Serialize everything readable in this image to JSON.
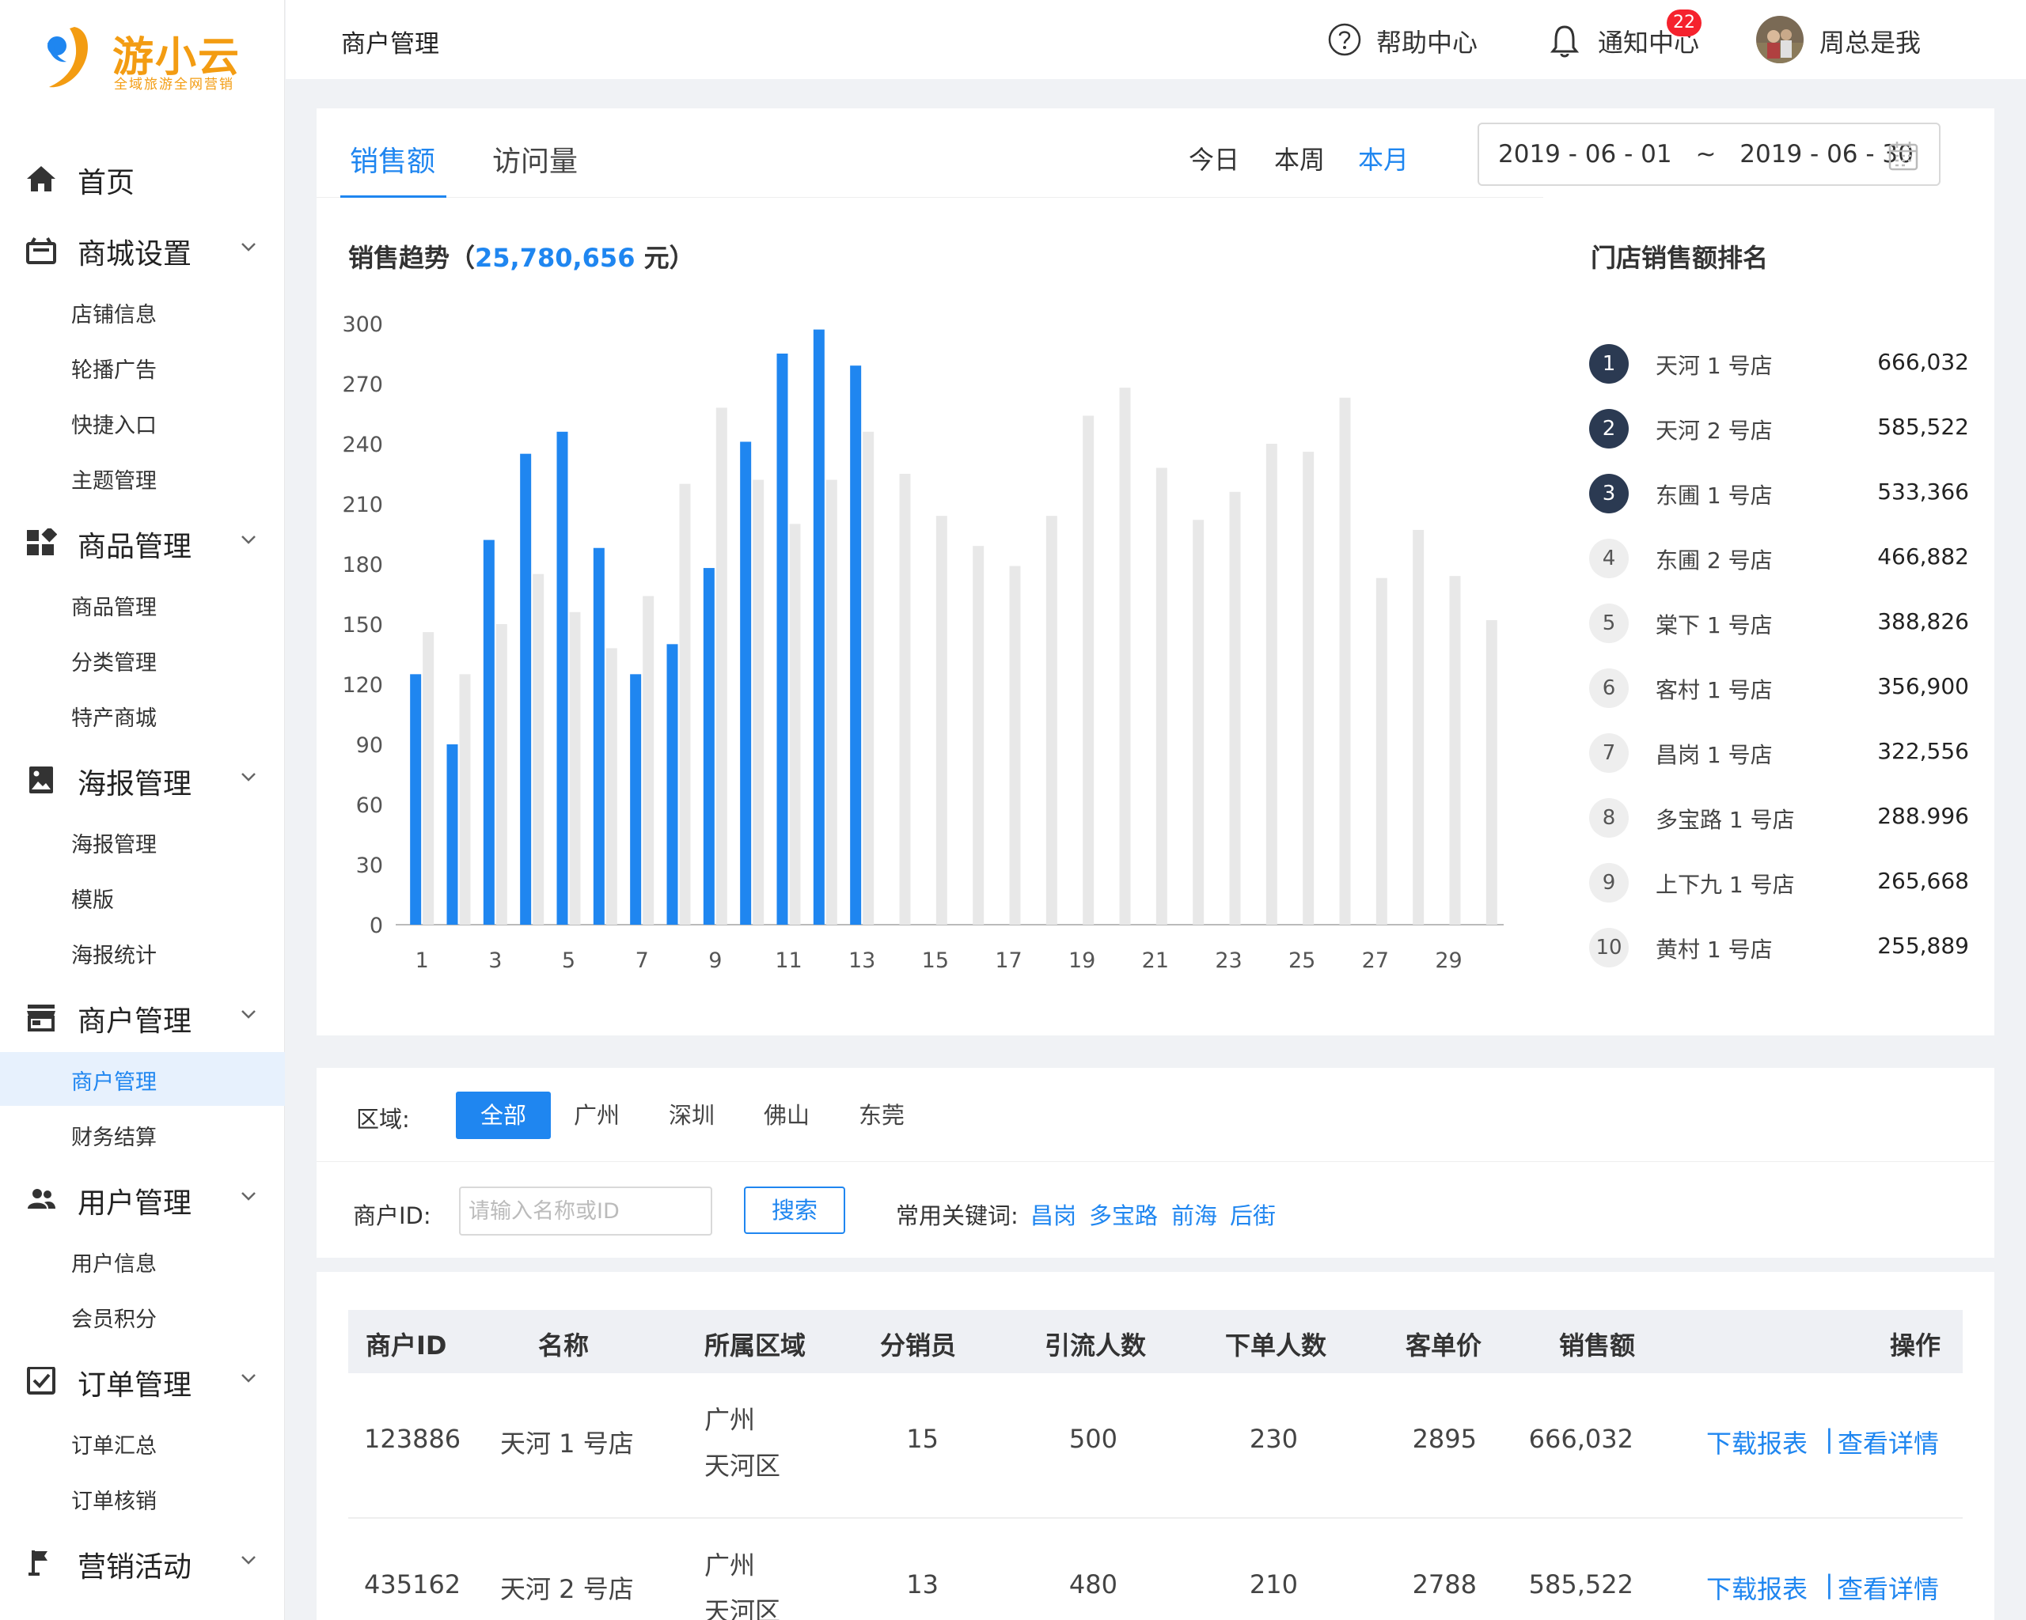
{
  "brand": {
    "name": "游小云",
    "slogan": "全域旅游全网营销",
    "accent": "#f39c12"
  },
  "colors": {
    "primary": "#1f86f0",
    "bar_gray": "#e8e8e8",
    "rank_dark": "#2b3a52"
  },
  "sidebar": {
    "home": "首页",
    "groups": [
      {
        "label": "商城设置",
        "icon": "shop-icon",
        "items": [
          "店铺信息",
          "轮播广告",
          "快捷入口",
          "主题管理"
        ]
      },
      {
        "label": "商品管理",
        "icon": "grid-icon",
        "items": [
          "商品管理",
          "分类管理",
          "特产商城"
        ]
      },
      {
        "label": "海报管理",
        "icon": "image-icon",
        "items": [
          "海报管理",
          "模版",
          "海报统计"
        ]
      },
      {
        "label": "商户管理",
        "icon": "store-icon",
        "items": [
          "商户管理",
          "财务结算"
        ]
      },
      {
        "label": "用户管理",
        "icon": "users-icon",
        "items": [
          "用户信息",
          "会员积分"
        ]
      },
      {
        "label": "订单管理",
        "icon": "checkbox-icon",
        "items": [
          "订单汇总",
          "订单核销"
        ]
      },
      {
        "label": "营销活动",
        "icon": "flag-icon",
        "items": []
      }
    ],
    "active_item": "商户管理"
  },
  "header": {
    "title": "商户管理",
    "help": "帮助中心",
    "notice": "通知中心",
    "notice_count": "22",
    "user": "周总是我"
  },
  "sales": {
    "tabs": [
      "销售额",
      "访问量"
    ],
    "periods": [
      "今日",
      "本周",
      "本月"
    ],
    "date_start": "2019 - 06 - 01",
    "date_sep": "~",
    "date_end": "2019 - 06 - 30",
    "trend_prefix": "销售趋势（",
    "trend_amount": "25,780,656",
    "trend_suffix": " 元）",
    "rank_title": "门店销售额排名",
    "ranking": [
      {
        "rank": "1",
        "name": "天河 1 号店",
        "value": "666,032"
      },
      {
        "rank": "2",
        "name": "天河 2 号店",
        "value": "585,522"
      },
      {
        "rank": "3",
        "name": "东圃 1 号店",
        "value": "533,366"
      },
      {
        "rank": "4",
        "name": "东圃 2 号店",
        "value": "466,882"
      },
      {
        "rank": "5",
        "name": "棠下 1 号店",
        "value": "388,826"
      },
      {
        "rank": "6",
        "name": "客村 1 号店",
        "value": "356,900"
      },
      {
        "rank": "7",
        "name": "昌岗 1 号店",
        "value": "322,556"
      },
      {
        "rank": "8",
        "name": "多宝路 1 号店",
        "value": "288.996"
      },
      {
        "rank": "9",
        "name": "上下九 1 号店",
        "value": "265,668"
      },
      {
        "rank": "10",
        "name": "黄村 1 号店",
        "value": "255,889"
      }
    ]
  },
  "chart_data": {
    "type": "bar",
    "categories": [
      1,
      2,
      3,
      4,
      5,
      6,
      7,
      8,
      9,
      10,
      11,
      12,
      13,
      14,
      15,
      16,
      17,
      18,
      19,
      20,
      21,
      22,
      23,
      24,
      25,
      26,
      27,
      28,
      29,
      30
    ],
    "xtick_labels": [
      "1",
      "3",
      "5",
      "7",
      "9",
      "11",
      "13",
      "15",
      "17",
      "19",
      "21",
      "23",
      "25",
      "27",
      "29"
    ],
    "yticks": [
      0,
      30,
      60,
      90,
      120,
      150,
      180,
      210,
      240,
      270,
      300
    ],
    "ylim": [
      0,
      300
    ],
    "series": [
      {
        "color": "#1f86f0",
        "values": [
          125,
          90,
          192,
          235,
          246,
          188,
          125,
          140,
          178,
          241,
          285,
          297,
          279,
          null,
          null,
          null,
          null,
          null,
          null,
          null,
          null,
          null,
          null,
          null,
          null,
          null,
          null,
          null,
          null,
          null
        ]
      },
      {
        "color": "#e8e8e8",
        "values": [
          146,
          125,
          150,
          175,
          156,
          138,
          164,
          220,
          258,
          222,
          200,
          222,
          246,
          225,
          204,
          189,
          179,
          204,
          254,
          268,
          228,
          202,
          216,
          240,
          236,
          263,
          173,
          197,
          174,
          152
        ]
      }
    ],
    "grid": false,
    "legend": "none"
  },
  "filters": {
    "region_label": "区域:",
    "regions": [
      "全部",
      "广州",
      "深圳",
      "佛山",
      "东莞"
    ],
    "merchant_label": "商户ID:",
    "merchant_placeholder": "请输入名称或ID",
    "search": "搜索",
    "keywords_label": "常用关键词:",
    "keywords": [
      "昌岗",
      "多宝路",
      "前海",
      "后街"
    ]
  },
  "table": {
    "headers": [
      "商户ID",
      "名称",
      "所属区域",
      "分销员",
      "引流人数",
      "下单人数",
      "客单价",
      "销售额",
      "操作"
    ],
    "rows": [
      {
        "id": "123886",
        "name": "天河 1 号店",
        "city": "广州",
        "district": "天河区",
        "dist": "15",
        "traffic": "500",
        "orders": "230",
        "price": "2895",
        "sales": "666,032",
        "download": "下载报表",
        "detail": "查看详情"
      },
      {
        "id": "435162",
        "name": "天河 2 号店",
        "city": "广州",
        "district": "天河区",
        "dist": "13",
        "traffic": "480",
        "orders": "210",
        "price": "2788",
        "sales": "585,522",
        "download": "下载报表",
        "detail": "查看详情"
      }
    ],
    "action_sep": "|"
  }
}
